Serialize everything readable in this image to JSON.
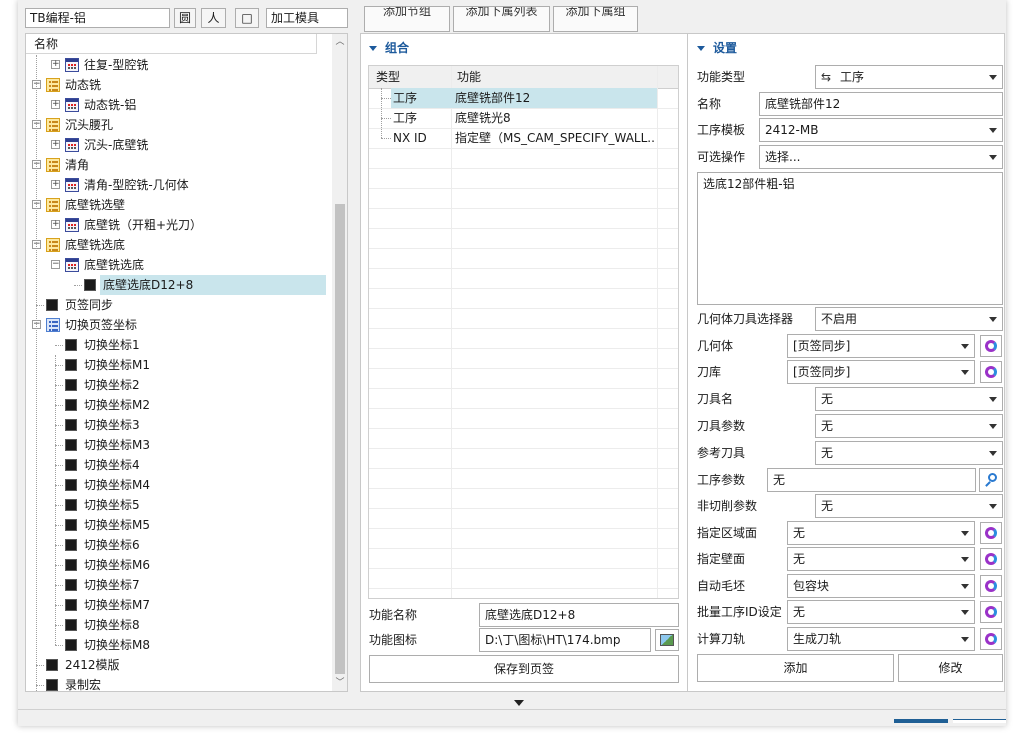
{
  "toolbar": {
    "search_value": "TB编程-铝",
    "btn1": "圆",
    "btn2": "人",
    "btn3": "□",
    "mode_value": "加工模具",
    "tab_add_group": "添加节组",
    "tab_add_list": "添加下属列表",
    "tab_add_sub": "添加下属组"
  },
  "tree": {
    "header": "名称",
    "rows": [
      {
        "label": "往复-型腔铣",
        "icon": "operation-icon",
        "level": 1,
        "expander": "+"
      },
      {
        "label": "动态铣",
        "icon": "folder-icon",
        "level": 0,
        "expander": "−"
      },
      {
        "label": "动态铣-铝",
        "icon": "operation-icon",
        "level": 1,
        "expander": "+"
      },
      {
        "label": "沉头腰孔",
        "icon": "folder-icon",
        "level": 0,
        "expander": "−"
      },
      {
        "label": "沉头-底壁铣",
        "icon": "operation-icon",
        "level": 1,
        "expander": "+"
      },
      {
        "label": "清角",
        "icon": "folder-icon",
        "level": 0,
        "expander": "−"
      },
      {
        "label": "清角-型腔铣-几何体",
        "icon": "operation-icon",
        "level": 1,
        "expander": "+"
      },
      {
        "label": "底壁铣选壁",
        "icon": "folder-icon",
        "level": 0,
        "expander": "−"
      },
      {
        "label": "底壁铣（开粗+光刀）",
        "icon": "operation-icon",
        "level": 1,
        "expander": "+"
      },
      {
        "label": "底壁铣选底",
        "icon": "folder-icon",
        "level": 0,
        "expander": "−"
      },
      {
        "label": "底壁铣选底",
        "icon": "operation-icon",
        "level": 1,
        "expander": "−"
      },
      {
        "label": "底壁选底D12+8",
        "icon": "block-icon",
        "level": 2,
        "expander": "",
        "selected": true
      },
      {
        "label": "页签同步",
        "icon": "block-icon",
        "level": 0,
        "expander": ""
      },
      {
        "label": "切换页签坐标",
        "icon": "list-icon",
        "level": 0,
        "expander": "−"
      },
      {
        "label": "切换坐标1",
        "icon": "block-icon",
        "level": 1,
        "expander": ""
      },
      {
        "label": "切换坐标M1",
        "icon": "block-icon",
        "level": 1,
        "expander": ""
      },
      {
        "label": "切换坐标2",
        "icon": "block-icon",
        "level": 1,
        "expander": ""
      },
      {
        "label": "切换坐标M2",
        "icon": "block-icon",
        "level": 1,
        "expander": ""
      },
      {
        "label": "切换坐标3",
        "icon": "block-icon",
        "level": 1,
        "expander": ""
      },
      {
        "label": "切换坐标M3",
        "icon": "block-icon",
        "level": 1,
        "expander": ""
      },
      {
        "label": "切换坐标4",
        "icon": "block-icon",
        "level": 1,
        "expander": ""
      },
      {
        "label": "切换坐标M4",
        "icon": "block-icon",
        "level": 1,
        "expander": ""
      },
      {
        "label": "切换坐标5",
        "icon": "block-icon",
        "level": 1,
        "expander": ""
      },
      {
        "label": "切换坐标M5",
        "icon": "block-icon",
        "level": 1,
        "expander": ""
      },
      {
        "label": "切换坐标6",
        "icon": "block-icon",
        "level": 1,
        "expander": ""
      },
      {
        "label": "切换坐标M6",
        "icon": "block-icon",
        "level": 1,
        "expander": ""
      },
      {
        "label": "切换坐标7",
        "icon": "block-icon",
        "level": 1,
        "expander": ""
      },
      {
        "label": "切换坐标M7",
        "icon": "block-icon",
        "level": 1,
        "expander": ""
      },
      {
        "label": "切换坐标8",
        "icon": "block-icon",
        "level": 1,
        "expander": ""
      },
      {
        "label": "切换坐标M8",
        "icon": "block-icon",
        "level": 1,
        "expander": ""
      },
      {
        "label": "2412模版",
        "icon": "block-icon",
        "level": 0,
        "expander": ""
      },
      {
        "label": "录制宏",
        "icon": "block-icon",
        "level": 0,
        "expander": ""
      }
    ]
  },
  "group": {
    "section_title": "组合",
    "columns": [
      "类型",
      "功能"
    ],
    "rows": [
      {
        "type": "工序",
        "func": "底壁铣部件12",
        "selected": true
      },
      {
        "type": "工序",
        "func": "底壁铣光8"
      },
      {
        "type": "NX ID",
        "func": "指定壁（MS_CAM_SPECIFY_WALL..."
      }
    ],
    "func_name_label": "功能名称",
    "func_name_value": "底壁选底D12+8",
    "func_icon_label": "功能图标",
    "func_icon_value": "D:\\丁\\图标\\HT\\174.bmp",
    "save_button": "保存到页签"
  },
  "settings": {
    "section_title": "设置",
    "func_type_label": "功能类型",
    "func_type_value": "工序",
    "name_label": "名称",
    "name_value": "底壁铣部件12",
    "template_label": "工序模板",
    "template_value": "2412-MB",
    "optional_label": "可选操作",
    "optional_value": "选择...",
    "notes_value": "选底12部件粗-铝",
    "geom_selector_label": "几何体刀具选择器",
    "geom_selector_value": "不启用",
    "geometry_label": "几何体",
    "geometry_value": "[页签同步]",
    "toolbank_label": "刀库",
    "toolbank_value": "[页签同步]",
    "toolname_label": "刀具名",
    "toolname_value": "无",
    "toolparam_label": "刀具参数",
    "toolparam_value": "无",
    "reftool_label": "参考刀具",
    "reftool_value": "无",
    "opparam_label": "工序参数",
    "opparam_value": "无",
    "noncut_label": "非切削参数",
    "noncut_value": "无",
    "area_label": "指定区域面",
    "area_value": "无",
    "wall_label": "指定壁面",
    "wall_value": "无",
    "blank_label": "自动毛坯",
    "blank_value": "包容块",
    "batchid_label": "批量工序ID设定",
    "batchid_value": "无",
    "calc_label": "计算刀轨",
    "calc_value": "生成刀轨",
    "add_button": "添加",
    "modify_button": "修改"
  },
  "colors": {
    "accent": "#1d5a9c",
    "selection": "#c9e5ec",
    "bottom_bar": "#1f5f95"
  }
}
